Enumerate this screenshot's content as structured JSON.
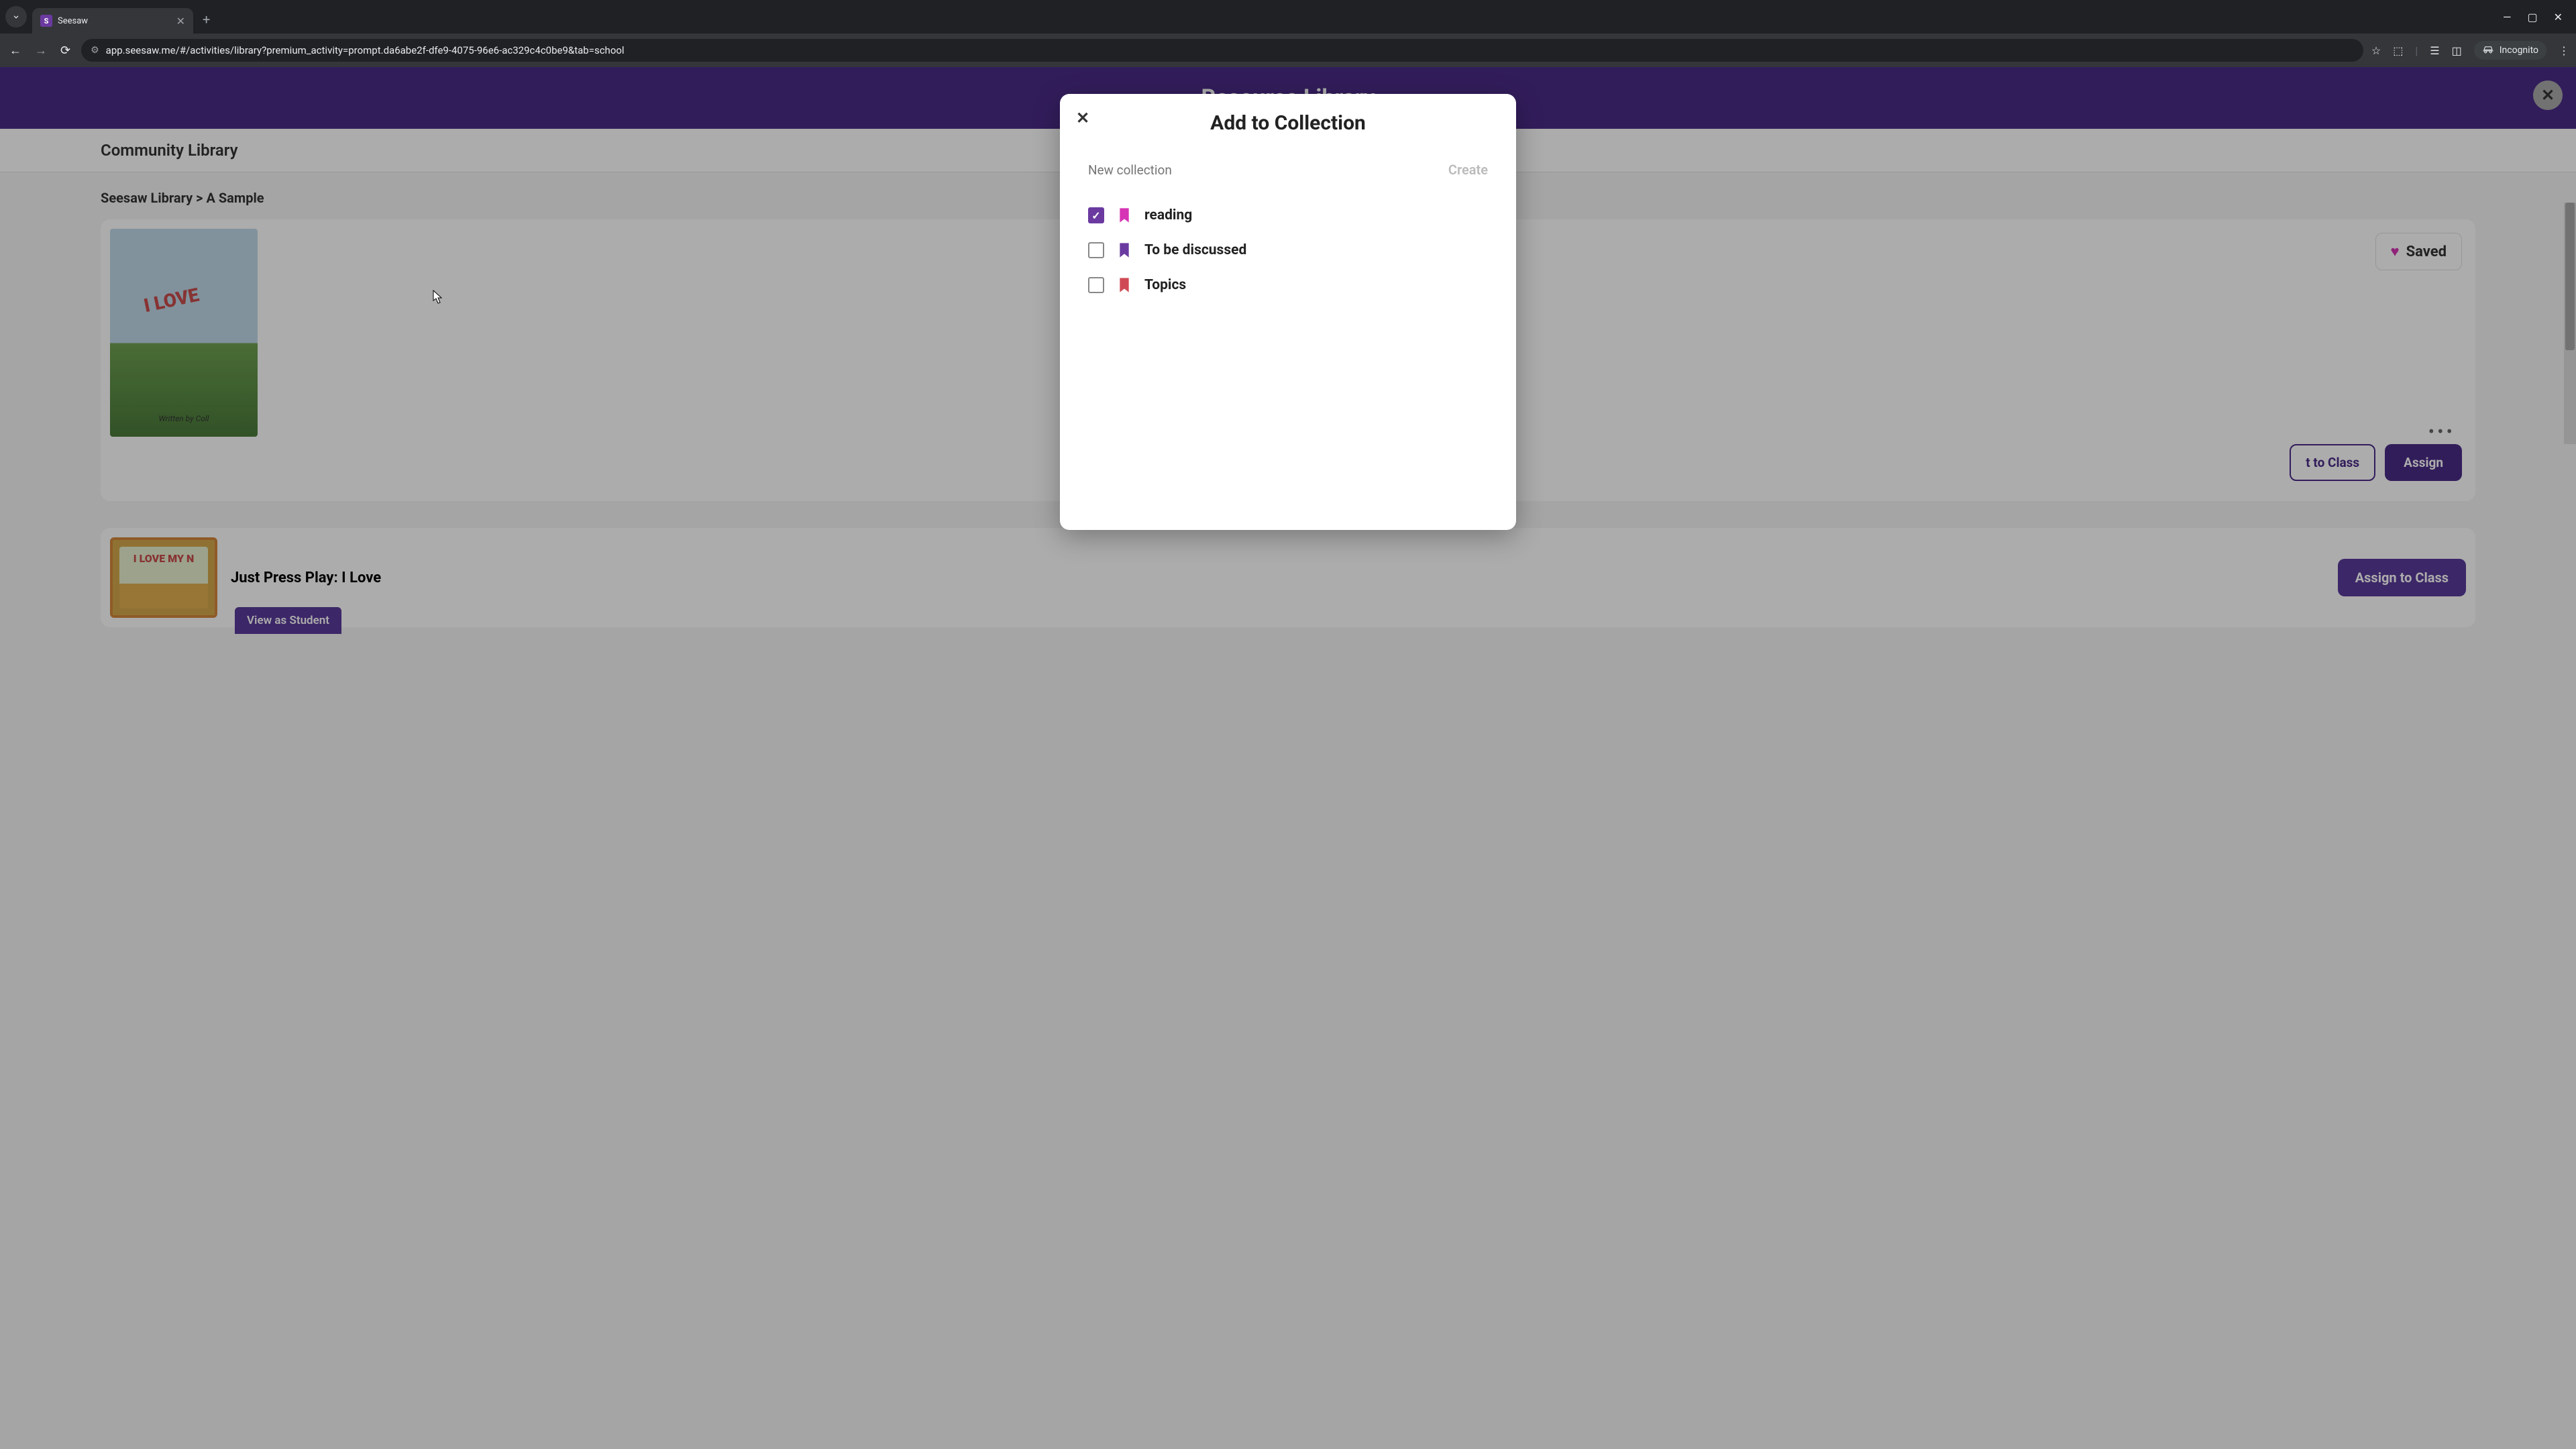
{
  "tab": {
    "title": "Seesaw",
    "favicon_letter": "S"
  },
  "url": "app.seesaw.me/#/activities/library?premium_activity=prompt.da6abe2f-dfe9-4075-96e6-ac329c4c0be9&tab=school",
  "incognito_label": "Incognito",
  "header": {
    "title": "Resource Library"
  },
  "subnav_label": "Community Library",
  "breadcrumb": "Seesaw Library > A Sample",
  "saved_label": "Saved",
  "buttons": {
    "present": "t to Class",
    "assign": "Assign",
    "assign_to_class": "Assign to Class",
    "view_student": "View as Student"
  },
  "lower_card_title": "Just Press Play: I Love",
  "thumb": {
    "love": "I LOVE",
    "author": "Written by Coll",
    "lower_love": "I LOVE MY N"
  },
  "modal": {
    "title": "Add to Collection",
    "new_placeholder": "New collection",
    "create_label": "Create",
    "collections": [
      {
        "label": "reading",
        "color": "#d633b5",
        "checked": true
      },
      {
        "label": "To be discussed",
        "color": "#6b3aa0",
        "checked": false
      },
      {
        "label": "Topics",
        "color": "#d04a55",
        "checked": false
      }
    ]
  }
}
